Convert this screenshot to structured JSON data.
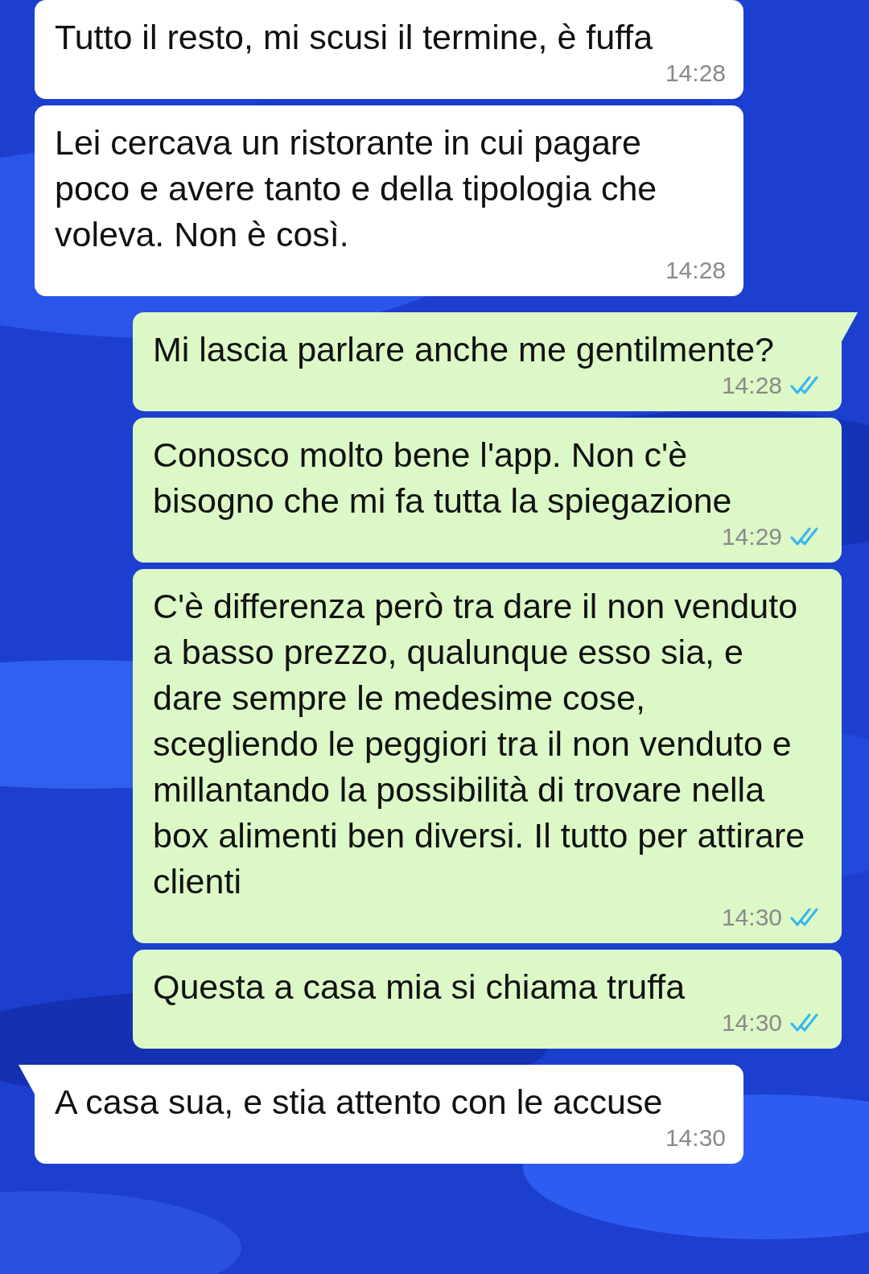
{
  "messages": [
    {
      "kind": "incoming",
      "tail": false,
      "text": "Tutto il resto, mi scusi il termine, è fuffa",
      "time": "14:28"
    },
    {
      "kind": "incoming",
      "tail": false,
      "text": "Lei cercava un ristorante in cui pagare poco e avere tanto e della tipologia che voleva. Non è così.",
      "time": "14:28"
    },
    {
      "kind": "outgoing",
      "tail": true,
      "text": "Mi lascia parlare anche me gentilmente?",
      "time": "14:28",
      "read": true
    },
    {
      "kind": "outgoing",
      "tail": false,
      "text": "Conosco molto bene l'app. Non c'è bisogno che mi fa tutta la spiegazione",
      "time": "14:29",
      "read": true
    },
    {
      "kind": "outgoing",
      "tail": false,
      "text": "C'è differenza però tra dare il non venduto a basso prezzo, qualunque esso sia, e dare sempre le medesime cose, scegliendo le peggiori tra il non venduto e millantando la possibilità di trovare nella box alimenti ben diversi. Il tutto per attirare clienti",
      "time": "14:30",
      "read": true
    },
    {
      "kind": "outgoing",
      "tail": false,
      "text": "Questa a casa mia si chiama truffa",
      "time": "14:30",
      "read": true
    },
    {
      "kind": "incoming",
      "tail": true,
      "text": "A casa sua, e stia attento con le accuse",
      "time": "14:30"
    }
  ]
}
